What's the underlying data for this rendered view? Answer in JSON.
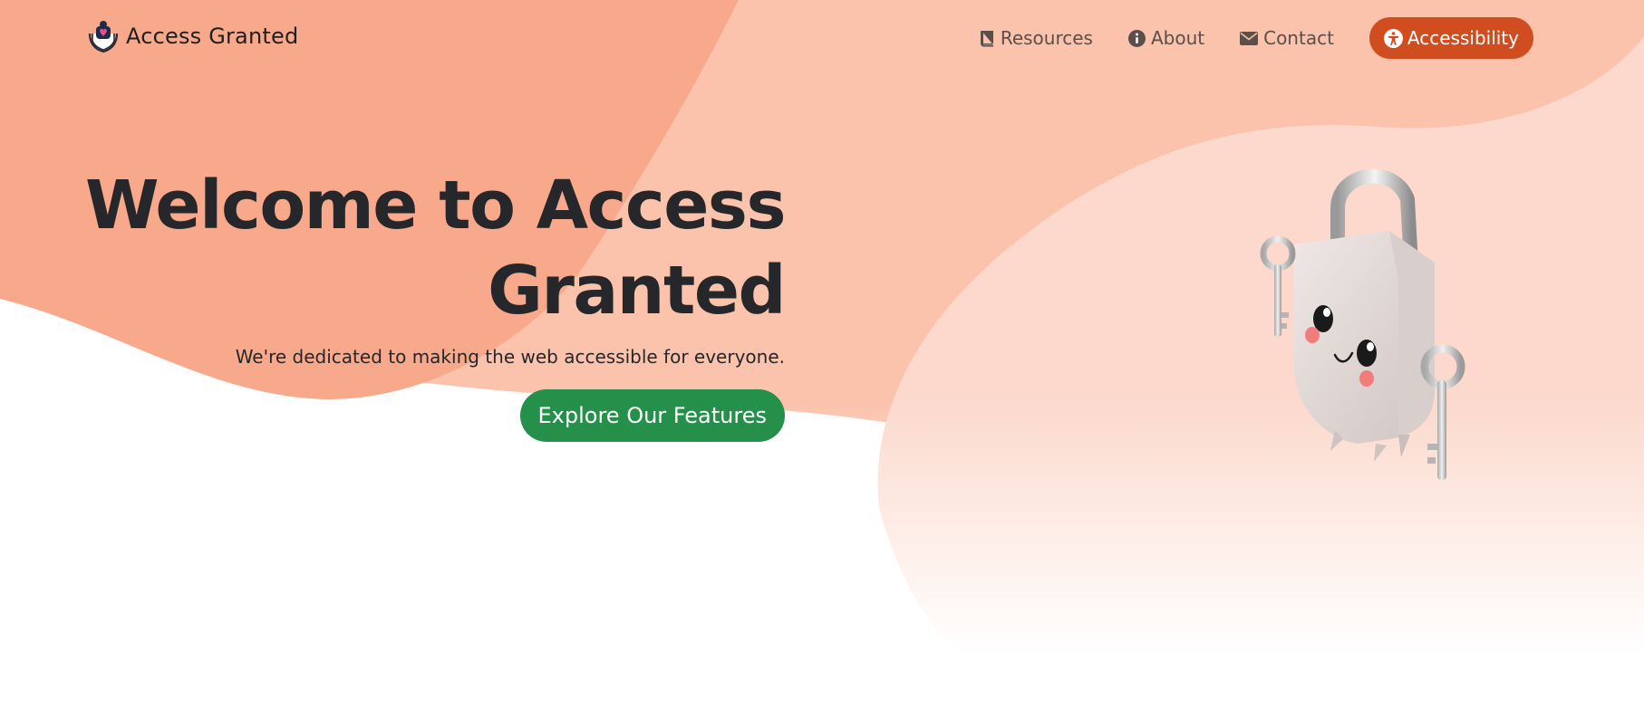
{
  "header": {
    "brand_name": "Access Granted",
    "brand_icon": "hands-heart-icon",
    "nav": [
      {
        "label": "Resources",
        "icon": "book-icon"
      },
      {
        "label": "About",
        "icon": "info-circle-icon"
      },
      {
        "label": "Contact",
        "icon": "envelope-icon"
      }
    ],
    "accessibility_button": {
      "label": "Accessibility",
      "icon": "universal-access-icon"
    }
  },
  "hero": {
    "title_line1": "Welcome to Access",
    "title_line2": "Granted",
    "subtitle": "We're dedicated to making the web accessible for everyone.",
    "cta_label": "Explore Our Features"
  },
  "illustration": {
    "name": "padlock-mascot-with-keys"
  },
  "colors": {
    "blob_dark": "#f9a98b",
    "blob_light": "#fbc2ac",
    "blob_pale": "#fcd9cc",
    "accent_button": "#cf4d1e",
    "cta_button": "#25904a",
    "text_dark": "#26272b",
    "nav_text": "#5b4f4b"
  }
}
